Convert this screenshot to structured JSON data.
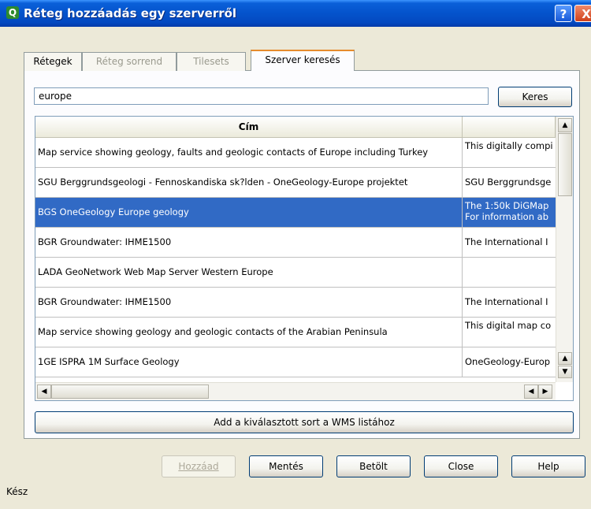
{
  "window": {
    "title": "Réteg hozzáadás egy szerverről",
    "app_icon": "Q",
    "help_label": "?",
    "close_label": "X"
  },
  "tabs": [
    {
      "label": "Rétegek"
    },
    {
      "label": "Réteg sorrend"
    },
    {
      "label": "Tilesets"
    },
    {
      "label": "Szerver keresés"
    }
  ],
  "search": {
    "value": "europe",
    "button_label": "Keres"
  },
  "table": {
    "columns": [
      "Cím",
      ""
    ],
    "rows": [
      {
        "title": "Map service showing geology, faults and geologic contacts of Europe including Turkey",
        "desc": "This digitally compi"
      },
      {
        "title": "SGU Berggrundsgeologi - Fennoskandiska sk?lden - OneGeology-Europe projektet",
        "desc": "SGU Berggrundsge"
      },
      {
        "title": "BGS OneGeology Europe geology",
        "desc": "The 1:50k DiGMap",
        "desc2": "For information ab"
      },
      {
        "title": "BGR Groundwater: IHME1500",
        "desc": "The International I"
      },
      {
        "title": "LADA GeoNetwork Web Map Server Western Europe",
        "desc": ""
      },
      {
        "title": "BGR Groundwater: IHME1500",
        "desc": "The International I"
      },
      {
        "title": "Map service showing geology and geologic contacts of the Arabian Peninsula",
        "desc": "This digital map co"
      },
      {
        "title": "1GE ISPRA 1M Surface Geology",
        "desc": "OneGeology-Europ"
      }
    ]
  },
  "add_row_button": "Add a kiválasztott sort a WMS listához",
  "buttons": {
    "add": "Hozzáad",
    "save": "Mentés",
    "load": "Betölt",
    "close": "Close",
    "help": "Help"
  },
  "status": "Kész"
}
